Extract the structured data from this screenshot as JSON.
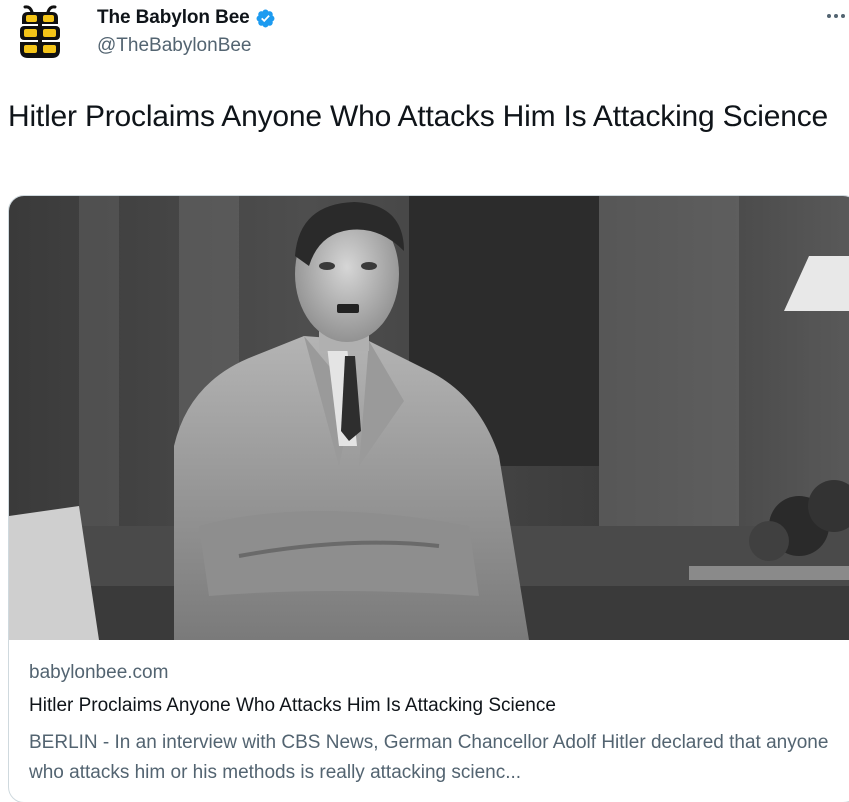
{
  "author": {
    "display_name": "The Babylon Bee",
    "handle": "@TheBabylonBee",
    "verified": true,
    "avatar_icon": "babylon-bee-logo-icon",
    "verified_icon": "verified-badge-icon"
  },
  "tweet": {
    "text": "Hitler Proclaims Anyone Who Attacks Him Is Attacking Science",
    "more_icon": "more-options-icon"
  },
  "card": {
    "domain": "babylonbee.com",
    "title": "Hitler Proclaims Anyone Who Attacks Him Is Attacking Science",
    "description": "BERLIN - In an interview with CBS News, German Chancellor Adolf Hitler declared that anyone who attacks him or his methods is really attacking scienc..."
  },
  "colors": {
    "verified": "#1d9bf0",
    "secondary_text": "#536471",
    "primary_text": "#0f1419",
    "border": "#cfd9de",
    "logo_yellow": "#f5c518"
  }
}
